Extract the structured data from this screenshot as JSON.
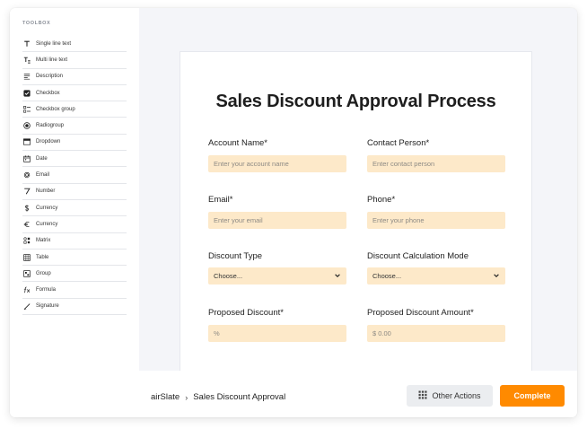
{
  "toolbox": {
    "title": "TOOLBOX",
    "items": [
      {
        "label": "Single line text",
        "icon": "single-line-text-icon"
      },
      {
        "label": "Multi line text",
        "icon": "multi-line-text-icon"
      },
      {
        "label": "Description",
        "icon": "description-icon"
      },
      {
        "label": "Checkbox",
        "icon": "checkbox-icon"
      },
      {
        "label": "Checkbox group",
        "icon": "checkbox-group-icon"
      },
      {
        "label": "Radiogroup",
        "icon": "radiogroup-icon"
      },
      {
        "label": "Dropdown",
        "icon": "dropdown-icon"
      },
      {
        "label": "Date",
        "icon": "calendar-icon"
      },
      {
        "label": "Email",
        "icon": "at-sign-icon"
      },
      {
        "label": "Number",
        "icon": "number-icon"
      },
      {
        "label": "Currency",
        "icon": "dollar-icon"
      },
      {
        "label": "Currency",
        "icon": "euro-icon"
      },
      {
        "label": "Matrix",
        "icon": "matrix-icon"
      },
      {
        "label": "Table",
        "icon": "table-icon"
      },
      {
        "label": "Group",
        "icon": "group-icon"
      },
      {
        "label": "Formula",
        "icon": "formula-icon"
      },
      {
        "label": "Signature",
        "icon": "signature-icon"
      }
    ]
  },
  "form": {
    "title": "Sales Discount Approval Process",
    "account_name": {
      "label": "Account Name*",
      "placeholder": "Enter your account name"
    },
    "contact_person": {
      "label": "Contact Person*",
      "placeholder": "Enter contact person"
    },
    "email": {
      "label": "Email*",
      "placeholder": "Enter your email"
    },
    "phone": {
      "label": "Phone*",
      "placeholder": "Enter your phone"
    },
    "discount_type": {
      "label": "Discount Type",
      "value": "Choose..."
    },
    "discount_calc_mode": {
      "label": "Discount Calculation Mode",
      "value": "Choose..."
    },
    "proposed_discount": {
      "label": "Proposed Discount*",
      "placeholder": "%"
    },
    "proposed_discount_amount": {
      "label": "Proposed Discount Amount*",
      "placeholder": "$ 0.00"
    }
  },
  "footer": {
    "breadcrumb_app": "airSlate",
    "breadcrumb_sep": "›",
    "breadcrumb_page": "Sales Discount Approval",
    "other_actions_label": "Other Actions",
    "complete_label": "Complete"
  },
  "colors": {
    "accent": "#ff8a00",
    "input_bg": "#fde9c9",
    "canvas_bg": "#f4f5f9"
  }
}
